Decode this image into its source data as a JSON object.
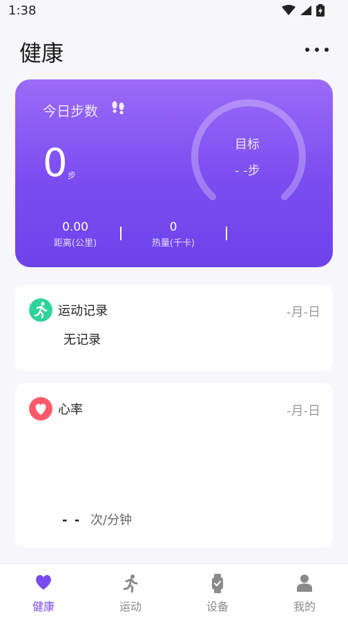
{
  "status_bar": {
    "time": "1:38"
  },
  "header": {
    "title": "健康"
  },
  "steps_card": {
    "title": "今日步数",
    "count": "0",
    "unit": "步",
    "goal_label": "目标",
    "goal_value": "- -步",
    "distance_value": "0.00",
    "distance_label": "距离(公里)",
    "calories_value": "0",
    "calories_label": "热量(千卡)",
    "gradient_top": "#9b6bf7",
    "gradient_bottom": "#6d43ea"
  },
  "exercise_card": {
    "title": "运动记录",
    "date": "-月-日",
    "empty": "无记录",
    "icon": "running-icon",
    "icon_color": "#2fd49a"
  },
  "heart_card": {
    "title": "心率",
    "date": "-月-日",
    "value": "- -",
    "unit": "次/分钟",
    "icon": "heart-icon",
    "icon_color": "#ff5a6a"
  },
  "bottom_nav": {
    "items": [
      {
        "label": "健康",
        "icon": "heart-icon",
        "active": true
      },
      {
        "label": "运动",
        "icon": "running-icon",
        "active": false
      },
      {
        "label": "设备",
        "icon": "watch-icon",
        "active": false
      },
      {
        "label": "我的",
        "icon": "person-icon",
        "active": false
      }
    ],
    "accent": "#7a4cf0"
  }
}
